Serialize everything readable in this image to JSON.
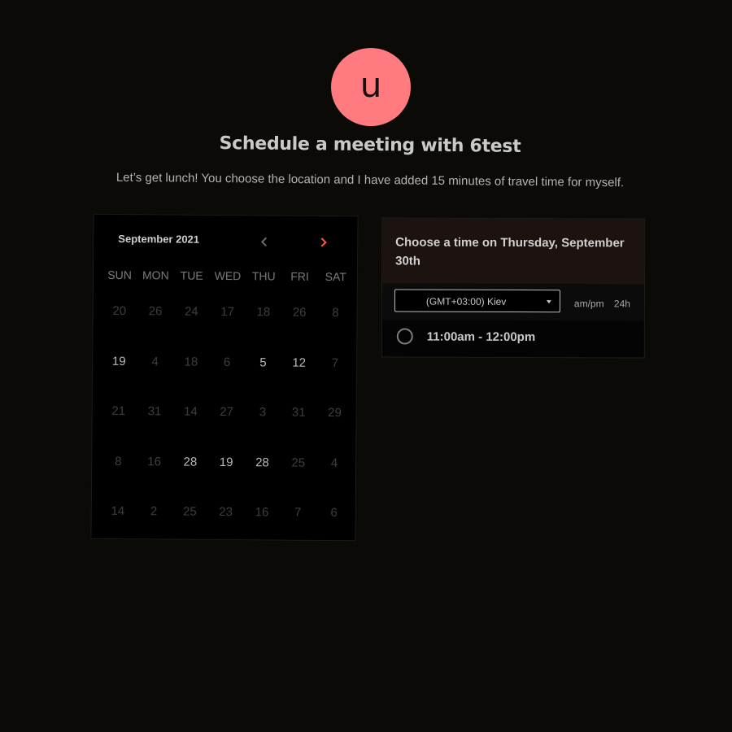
{
  "host": {
    "avatar_letter": "u",
    "avatar_color": "#ff7b80"
  },
  "header": {
    "title": "Schedule a meeting with 6test",
    "subtitle": "Let’s get lunch! You choose the location and I have added 15 minutes of travel time for myself."
  },
  "calendar": {
    "month_label": "September 2021",
    "prev_icon": "chevron-left-icon",
    "next_icon": "chevron-right-icon",
    "accent_color": "#ff5a3c",
    "weekdays": [
      "SUN",
      "MON",
      "TUE",
      "WED",
      "THU",
      "FRI",
      "SAT"
    ],
    "weeks": [
      [
        {
          "d": "20",
          "a": false
        },
        {
          "d": "26",
          "a": false
        },
        {
          "d": "24",
          "a": false
        },
        {
          "d": "17",
          "a": false
        },
        {
          "d": "18",
          "a": false
        },
        {
          "d": "26",
          "a": false
        },
        {
          "d": "8",
          "a": false
        }
      ],
      [
        {
          "d": "19",
          "a": true
        },
        {
          "d": "4",
          "a": false
        },
        {
          "d": "18",
          "a": false
        },
        {
          "d": "6",
          "a": false
        },
        {
          "d": "5",
          "a": true
        },
        {
          "d": "12",
          "a": true
        },
        {
          "d": "7",
          "a": false
        }
      ],
      [
        {
          "d": "21",
          "a": false
        },
        {
          "d": "31",
          "a": false
        },
        {
          "d": "14",
          "a": false
        },
        {
          "d": "27",
          "a": false
        },
        {
          "d": "3",
          "a": false
        },
        {
          "d": "31",
          "a": false
        },
        {
          "d": "29",
          "a": false
        }
      ],
      [
        {
          "d": "8",
          "a": false
        },
        {
          "d": "16",
          "a": false
        },
        {
          "d": "28",
          "a": true
        },
        {
          "d": "19",
          "a": true
        },
        {
          "d": "28",
          "a": true
        },
        {
          "d": "25",
          "a": false
        },
        {
          "d": "4",
          "a": false
        }
      ],
      [
        {
          "d": "14",
          "a": false
        },
        {
          "d": "2",
          "a": false
        },
        {
          "d": "25",
          "a": false
        },
        {
          "d": "23",
          "a": false
        },
        {
          "d": "16",
          "a": false
        },
        {
          "d": "7",
          "a": false
        },
        {
          "d": "6",
          "a": false
        }
      ]
    ]
  },
  "time_panel": {
    "title": "Choose a time on Thursday, September 30th",
    "timezone": "(GMT+03:00) Kiev",
    "format_ampm": "am/pm",
    "format_24h": "24h",
    "slots": [
      "11:00am - 12:00pm"
    ]
  }
}
